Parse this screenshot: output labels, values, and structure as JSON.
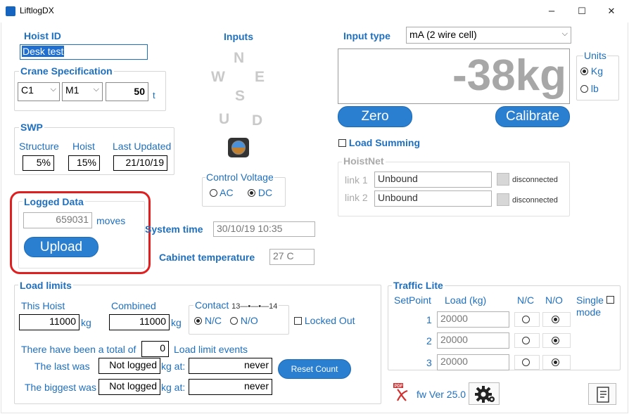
{
  "window": {
    "title": "LiftlogDX",
    "minimize": "–",
    "maximize": "☐",
    "close": "✕"
  },
  "hoist": {
    "label": "Hoist ID",
    "value": "Desk test"
  },
  "crane": {
    "label": "Crane Specification",
    "class_value": "C1",
    "mech_value": "M1",
    "capacity": "50",
    "capacity_unit": "t"
  },
  "swp": {
    "label": "SWP",
    "structure_label": "Structure",
    "hoist_label": "Hoist",
    "updated_label": "Last Updated",
    "structure_value": "5%",
    "hoist_value": "15%",
    "updated_value": "21/10/19"
  },
  "inputs": {
    "label": "Inputs",
    "n": "N",
    "w": "W",
    "e": "E",
    "s": "S",
    "u": "U",
    "d": "D"
  },
  "control_voltage": {
    "label": "Control Voltage",
    "ac": "AC",
    "dc": "DC",
    "selected": "DC"
  },
  "logged": {
    "label": "Logged Data",
    "value": "659031",
    "unit": "moves",
    "upload": "Upload"
  },
  "system": {
    "time_label": "System time",
    "time_value": "30/10/19 10:35",
    "temp_label": "Cabinet temperature",
    "temp_value": "27 C"
  },
  "input_type": {
    "label": "Input type",
    "value": "mA (2 wire cell)"
  },
  "display": {
    "load": "-38kg"
  },
  "units": {
    "label": "Units",
    "kg": "Kg",
    "lb": "lb",
    "selected": "Kg"
  },
  "actions": {
    "zero": "Zero",
    "calibrate": "Calibrate"
  },
  "load_summing": {
    "label": "Load Summing"
  },
  "hoistnet": {
    "label": "HoistNet",
    "link1_label": "link 1",
    "link1_value": "Unbound",
    "link1_status": "disconnected",
    "link2_label": "link 2",
    "link2_value": "Unbound",
    "link2_status": "disconnected"
  },
  "load_limits": {
    "label": "Load limits",
    "this_hoist_label": "This Hoist",
    "this_hoist_value": "11000",
    "this_hoist_unit": "kg",
    "combined_label": "Combined",
    "combined_value": "11000",
    "combined_unit": "kg",
    "contact_label": "Contact",
    "contact_from": "13",
    "contact_to": "14",
    "nc": "N/C",
    "no": "N/O",
    "contact_selected": "N/C",
    "locked_out": "Locked Out",
    "events_prefix": "There have been a total of",
    "events_value": "0",
    "events_suffix": "Load limit events",
    "last_label": "The last was",
    "last_value": "Not logged",
    "last_at_label": "kg at:",
    "last_at_value": "never",
    "biggest_label": "The biggest was",
    "biggest_value": "Not logged",
    "biggest_at_label": "kg at:",
    "biggest_at_value": "never",
    "reset": "Reset Count"
  },
  "traffic": {
    "label": "Traffic Lite",
    "setpoint_header": "SetPoint",
    "load_header": "Load (kg)",
    "nc_header": "N/C",
    "no_header": "N/O",
    "single_mode": "Single mode",
    "rows": [
      {
        "num": "1",
        "load": "20000",
        "selected": "N/O"
      },
      {
        "num": "2",
        "load": "20000",
        "selected": "N/O"
      },
      {
        "num": "3",
        "load": "20000",
        "selected": "N/O"
      }
    ]
  },
  "footer": {
    "fw": "fw Ver 25.0",
    "pdf_icon": "pdf-icon",
    "settings_icon": "gear-icon",
    "report_icon": "report-icon"
  },
  "colors": {
    "accent": "#1f6fbf",
    "button": "#2a7fd0",
    "highlight": "#e02020",
    "display_text": "#a7a7a7"
  }
}
